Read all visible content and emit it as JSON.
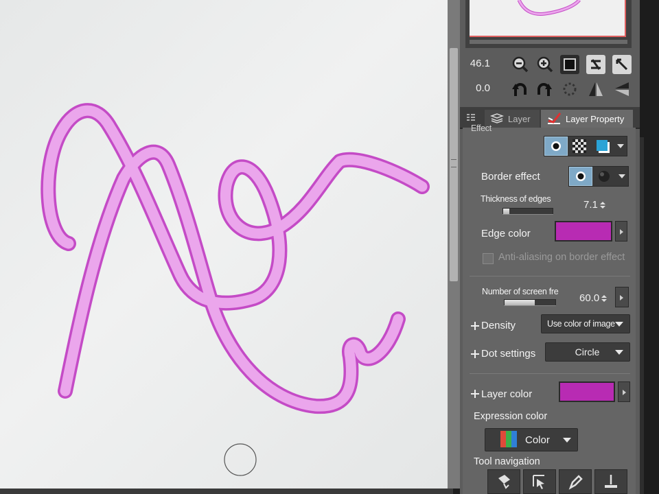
{
  "navigator": {
    "zoom_value": "46.1",
    "rotation_value": "0.0"
  },
  "tabs": [
    {
      "label": "Layer",
      "icon": "layers-icon"
    },
    {
      "label": "Layer Property",
      "icon": "layer-property-icon"
    }
  ],
  "layer_property": {
    "effect_label": "Effect",
    "border_effect_label": "Border effect",
    "thickness_label": "Thickness of edges",
    "thickness_value": "7.1",
    "thickness_fraction": 0.12,
    "edge_color_label": "Edge color",
    "edge_color": "#b82bb3",
    "antialias_label": "Anti-aliasing on border effect",
    "screen_freq_label": "Number of screen fre",
    "screen_freq_value": "60.0",
    "screen_freq_fraction": 0.6,
    "density_label": "Density",
    "density_value": "Use color of image",
    "dot_settings_label": "Dot settings",
    "dot_settings_value": "Circle",
    "layer_color_label": "Layer color",
    "layer_color": "#b82bb3",
    "expression_color_label": "Expression color",
    "expression_color_value": "Color",
    "tool_navigation_label": "Tool navigation"
  },
  "colors": {
    "stroke_fill": "#eba6ec",
    "stroke_edge": "#c44bc6",
    "panel_bg": "#656565",
    "canvas_bg": "#ebecec"
  }
}
